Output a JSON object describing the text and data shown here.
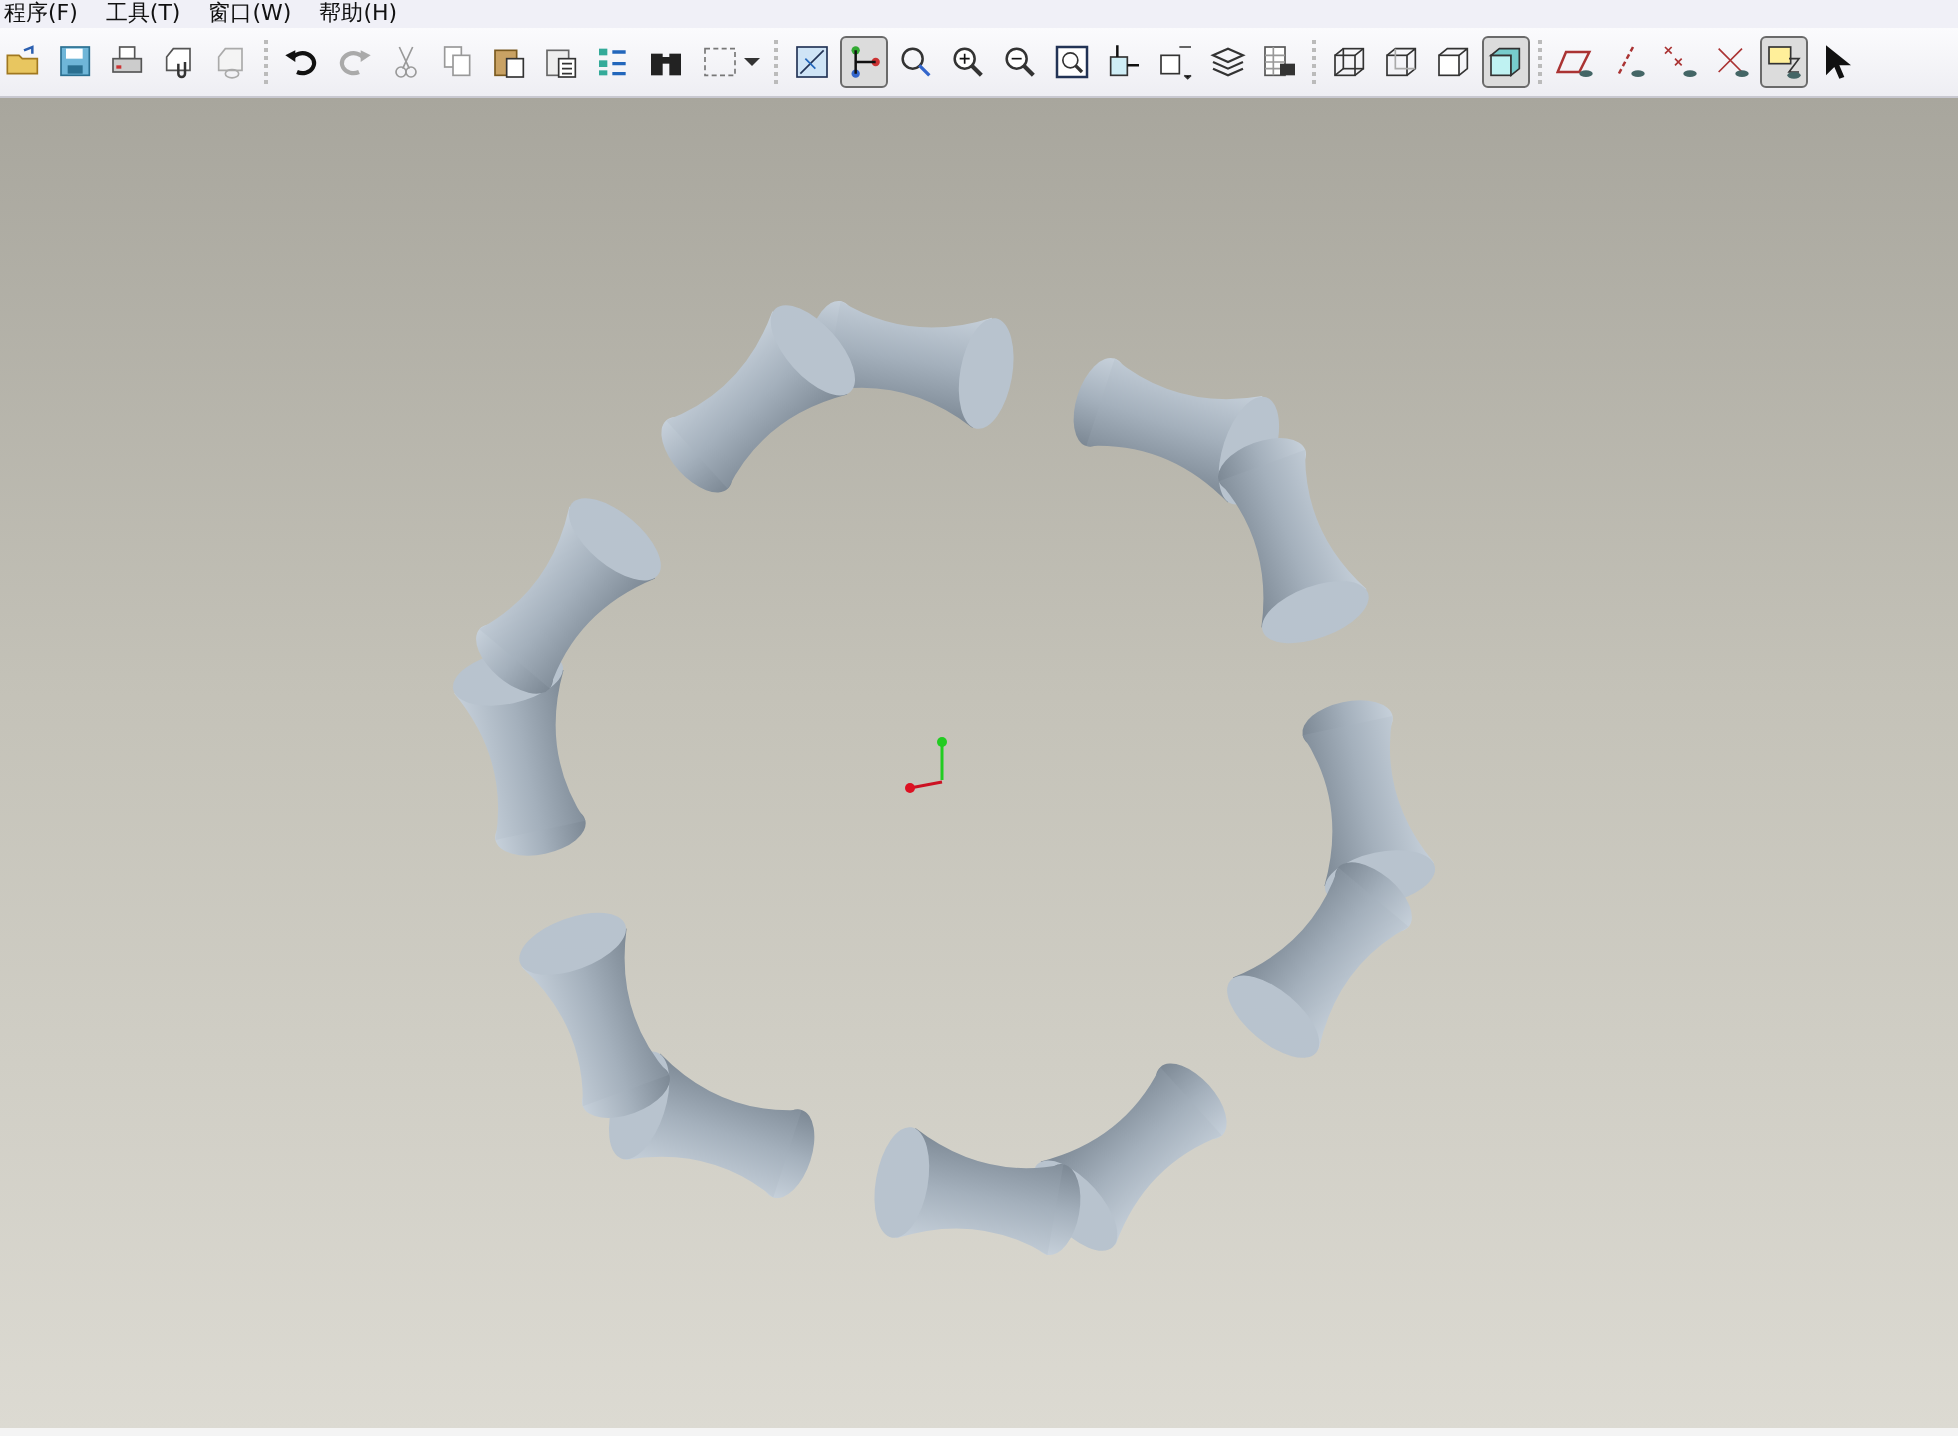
{
  "menu": [
    {
      "label": "程序(F)"
    },
    {
      "label": "工具(T)"
    },
    {
      "label": "窗口(W)"
    },
    {
      "label": "帮助(H)"
    }
  ],
  "toolbar": [
    {
      "kind": "button",
      "selected": false
    },
    {
      "kind": "button",
      "selected": false
    },
    {
      "kind": "button",
      "selected": false
    },
    {
      "kind": "button",
      "selected": false
    },
    {
      "kind": "button",
      "selected": false
    },
    {
      "kind": "separator"
    },
    {
      "kind": "button",
      "selected": false
    },
    {
      "kind": "button",
      "selected": false
    },
    {
      "kind": "button",
      "selected": false
    },
    {
      "kind": "button",
      "selected": false
    },
    {
      "kind": "button",
      "selected": false
    },
    {
      "kind": "button",
      "selected": false
    },
    {
      "kind": "button",
      "selected": false
    },
    {
      "kind": "button",
      "selected": false
    },
    {
      "kind": "dropdown",
      "selected": false
    },
    {
      "kind": "separator"
    },
    {
      "kind": "button",
      "selected": false
    },
    {
      "kind": "button",
      "selected": true
    },
    {
      "kind": "button",
      "selected": false
    },
    {
      "kind": "button",
      "selected": false
    },
    {
      "kind": "button",
      "selected": false
    },
    {
      "kind": "button",
      "selected": false
    },
    {
      "kind": "button",
      "selected": false
    },
    {
      "kind": "button",
      "selected": false
    },
    {
      "kind": "button",
      "selected": false
    },
    {
      "kind": "button",
      "selected": false
    },
    {
      "kind": "separator"
    },
    {
      "kind": "button",
      "selected": false
    },
    {
      "kind": "button",
      "selected": false
    },
    {
      "kind": "button",
      "selected": false
    },
    {
      "kind": "button",
      "selected": true
    },
    {
      "kind": "separator"
    },
    {
      "kind": "button",
      "selected": false
    },
    {
      "kind": "button",
      "selected": false
    },
    {
      "kind": "button",
      "selected": false
    },
    {
      "kind": "button",
      "selected": false
    },
    {
      "kind": "button",
      "selected": true
    },
    {
      "kind": "button",
      "selected": false
    }
  ]
}
